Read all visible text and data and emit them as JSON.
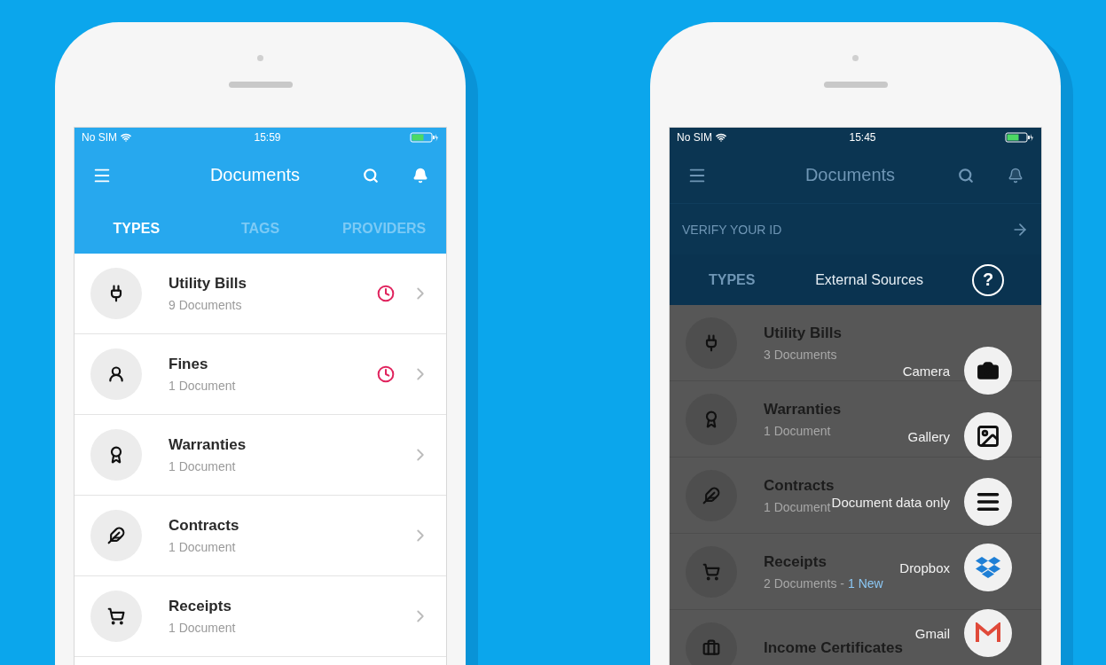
{
  "phones": [
    {
      "kind": "list",
      "status": {
        "carrier": "No SIM",
        "time": "15:59"
      },
      "header": {
        "title": "Documents"
      },
      "tabs": [
        {
          "label": "TYPES",
          "selected": true
        },
        {
          "label": "TAGS",
          "selected": false
        },
        {
          "label": "PROVIDERS",
          "selected": false
        }
      ],
      "rows": [
        {
          "title": "Utility Bills",
          "subtitle": "9 Documents",
          "alert": true
        },
        {
          "title": "Fines",
          "subtitle": "1 Document",
          "alert": true
        },
        {
          "title": "Warranties",
          "subtitle": "1 Document",
          "alert": false
        },
        {
          "title": "Contracts",
          "subtitle": "1 Document",
          "alert": false
        },
        {
          "title": "Receipts",
          "subtitle": "1 Document",
          "alert": false
        }
      ]
    },
    {
      "kind": "menu",
      "status": {
        "carrier": "No SIM",
        "time": "15:45"
      },
      "header": {
        "title": "Documents"
      },
      "banner": {
        "label": "VERIFY YOUR ID"
      },
      "tabs": [
        {
          "label": "TYPES",
          "selected": false
        }
      ],
      "rows": [
        {
          "title": "Utility Bills",
          "subtitle": "3 Documents"
        },
        {
          "title": "Warranties",
          "subtitle": "1 Document"
        },
        {
          "title": "Contracts",
          "subtitle": "1 Document"
        },
        {
          "title": "Receipts",
          "subtitle": "2 Documents -",
          "new_label": "1 New"
        },
        {
          "title": "Income Certificates"
        }
      ],
      "sources": {
        "title": "External Sources",
        "help": "?",
        "actions": [
          {
            "label": "Camera",
            "kind": "camera"
          },
          {
            "label": "Gallery",
            "kind": "gallery"
          },
          {
            "label": "Document data only",
            "kind": "data"
          },
          {
            "label": "Dropbox",
            "kind": "dropbox"
          },
          {
            "label": "Gmail",
            "kind": "gmail"
          }
        ]
      }
    }
  ]
}
